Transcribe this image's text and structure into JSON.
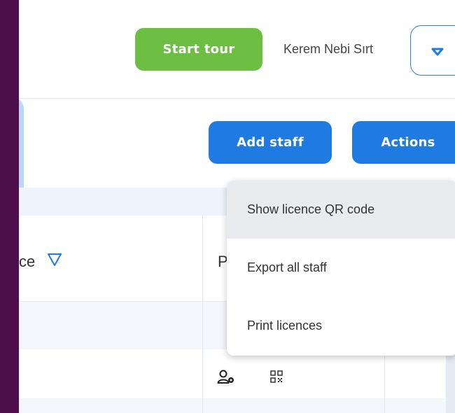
{
  "header": {
    "start_tour_label": "Start tour",
    "user_name": "Kerem Nebi Sırt"
  },
  "toolbar": {
    "add_staff_label": "Add staff",
    "actions_label": "Actions"
  },
  "table": {
    "columns": [
      {
        "label": "ce",
        "filter_icon": "filter-icon"
      },
      {
        "label": "P"
      }
    ],
    "row_icons": [
      "user-settings-icon",
      "qr-code-icon"
    ]
  },
  "actions_menu": {
    "items": [
      {
        "label": "Show licence QR code",
        "hovered": true
      },
      {
        "label": "Export all staff",
        "hovered": false
      },
      {
        "label": "Print licences",
        "hovered": false
      }
    ]
  },
  "colors": {
    "frame": "#4e0f4c",
    "start_tour": "#6cbf43",
    "primary": "#1f7be2",
    "tooltip": "#b9d7f6"
  }
}
